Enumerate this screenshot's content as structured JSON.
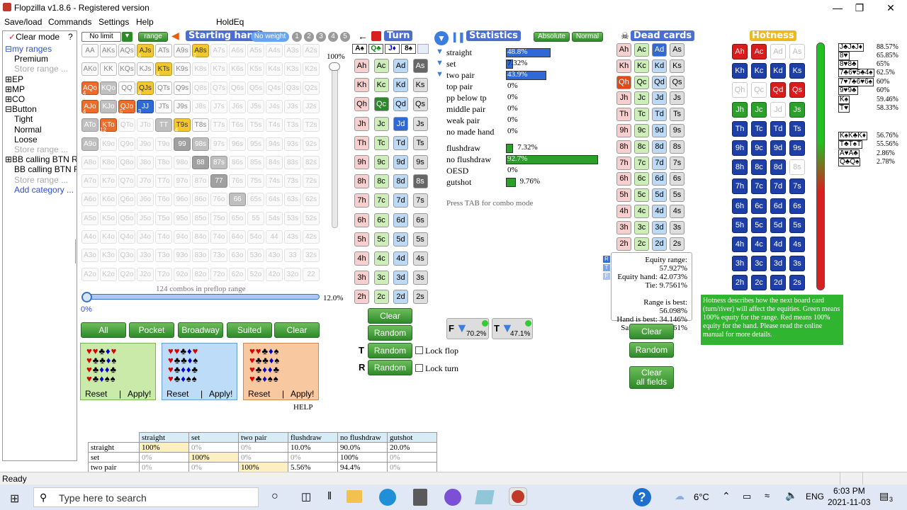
{
  "app": {
    "title": "Flopzilla v1.8.6 - Registered version"
  },
  "menu": {
    "items": [
      "Save/load",
      "Commands",
      "Settings",
      "Help",
      "HoldEq"
    ]
  },
  "left": {
    "clear_mode": "Clear mode",
    "help": "?",
    "items": [
      {
        "t": "⊟my ranges",
        "c": "blue"
      },
      {
        "t": "Premium",
        "c": ""
      },
      {
        "t": "Store range ...",
        "c": "grey"
      },
      {
        "t": "⊞EP",
        "c": ""
      },
      {
        "t": "⊞MP",
        "c": ""
      },
      {
        "t": "⊞CO",
        "c": ""
      },
      {
        "t": "⊟Button",
        "c": ""
      },
      {
        "t": "Tight",
        "c": ""
      },
      {
        "t": "Normal",
        "c": ""
      },
      {
        "t": "Loose",
        "c": ""
      },
      {
        "t": "Store range ...",
        "c": "grey"
      },
      {
        "t": "⊞BB calling BTN R",
        "c": ""
      },
      {
        "t": "BB calling BTN R",
        "c": ""
      },
      {
        "t": "Store range ...",
        "c": "grey"
      },
      {
        "t": "Add category ...",
        "c": "blue"
      }
    ]
  },
  "toolbar": {
    "limit": "No limit",
    "range": "range",
    "starting_hand": "Starting hand",
    "no_weight": "No weight",
    "weights": [
      "1",
      "2",
      "3",
      "4",
      "5"
    ],
    "pct": "100%"
  },
  "grid": {
    "combos": "124 combos in preflop range",
    "pct": "12.0%",
    "zero": "0%",
    "rows": [
      [
        "AA",
        "AKs",
        "AQs",
        "AJs",
        "ATs",
        "A9s",
        "A8s",
        "A7s",
        "A6s",
        "A5s",
        "A4s",
        "A3s",
        "A2s"
      ],
      [
        "AKo",
        "KK",
        "KQs",
        "KJs",
        "KTs",
        "K9s",
        "K8s",
        "K7s",
        "K6s",
        "K5s",
        "K4s",
        "K3s",
        "K2s"
      ],
      [
        "AQo",
        "KQo",
        "QQ",
        "QJs",
        "QTs",
        "Q9s",
        "Q8s",
        "Q7s",
        "Q6s",
        "Q5s",
        "Q4s",
        "Q3s",
        "Q2s"
      ],
      [
        "AJo",
        "KJo",
        "QJo",
        "JJ",
        "JTs",
        "J9s",
        "J8s",
        "J7s",
        "J6s",
        "J5s",
        "J4s",
        "J3s",
        "J2s"
      ],
      [
        "ATo",
        "KTo",
        "QTo",
        "JTo",
        "TT",
        "T9s",
        "T8s",
        "T7s",
        "T6s",
        "T5s",
        "T4s",
        "T3s",
        "T2s"
      ],
      [
        "A9o",
        "K9o",
        "Q9o",
        "J9o",
        "T9o",
        "99",
        "98s",
        "97s",
        "96s",
        "95s",
        "94s",
        "93s",
        "92s"
      ],
      [
        "A8o",
        "K8o",
        "Q8o",
        "J8o",
        "T8o",
        "98o",
        "88",
        "87s",
        "86s",
        "85s",
        "84s",
        "83s",
        "82s"
      ],
      [
        "A7o",
        "K7o",
        "Q7o",
        "J7o",
        "T7o",
        "97o",
        "87o",
        "77",
        "76s",
        "75s",
        "74s",
        "73s",
        "72s"
      ],
      [
        "A6o",
        "K6o",
        "Q6o",
        "J6o",
        "T6o",
        "96o",
        "86o",
        "76o",
        "66",
        "65s",
        "64s",
        "63s",
        "62s"
      ],
      [
        "A5o",
        "K5o",
        "Q5o",
        "J5o",
        "T5o",
        "95o",
        "85o",
        "75o",
        "65o",
        "55",
        "54s",
        "53s",
        "52s"
      ],
      [
        "A4o",
        "K4o",
        "Q4o",
        "J4o",
        "T4o",
        "94o",
        "84o",
        "74o",
        "64o",
        "54o",
        "44",
        "43s",
        "42s"
      ],
      [
        "A3o",
        "K3o",
        "Q3o",
        "J3o",
        "T3o",
        "93o",
        "83o",
        "73o",
        "63o",
        "53o",
        "43o",
        "33",
        "32s"
      ],
      [
        "A2o",
        "K2o",
        "Q2o",
        "J2o",
        "T2o",
        "92o",
        "82o",
        "72o",
        "62o",
        "52o",
        "42o",
        "32o",
        "22"
      ]
    ],
    "badges": {
      "AJs": "4",
      "A8s": "2",
      "KTs": "4",
      "QJs": "4",
      "T9s": "4",
      "AQo": "4",
      "AJo": "4",
      "QJo": "5",
      "JJ": "3",
      "KTo": "12"
    }
  },
  "buttons": {
    "all": "All",
    "pocket": "Pocket",
    "broadway": "Broadway",
    "suited": "Suited",
    "clear": "Clear",
    "reset": "Reset",
    "apply": "Apply!",
    "help": "HELP"
  },
  "board": {
    "title": "Turn",
    "flop": [
      "A♠",
      "Q♣",
      "J♦",
      "8♠"
    ],
    "cards": [
      [
        "Ah",
        "Ac",
        "Ad",
        "As"
      ],
      [
        "Kh",
        "Kc",
        "Kd",
        "Ks"
      ],
      [
        "Qh",
        "Qc",
        "Qd",
        "Qs"
      ],
      [
        "Jh",
        "Jc",
        "Jd",
        "Js"
      ],
      [
        "Th",
        "Tc",
        "Td",
        "Ts"
      ],
      [
        "9h",
        "9c",
        "9d",
        "9s"
      ],
      [
        "8h",
        "8c",
        "8d",
        "8s"
      ],
      [
        "7h",
        "7c",
        "7d",
        "7s"
      ],
      [
        "6h",
        "6c",
        "6d",
        "6s"
      ],
      [
        "5h",
        "5c",
        "5d",
        "5s"
      ],
      [
        "4h",
        "4c",
        "4d",
        "4s"
      ],
      [
        "3h",
        "3c",
        "3d",
        "3s"
      ],
      [
        "2h",
        "2c",
        "2d",
        "2s"
      ]
    ],
    "clear": "Clear",
    "random": "Random",
    "lock_flop": "Lock flop",
    "lock_turn": "Lock turn"
  },
  "stats": {
    "title": "Statistics",
    "absolute": "Absolute",
    "normal": "Normal",
    "tab_hint": "Press TAB for combo mode",
    "rows": [
      {
        "l": "straight",
        "v": "48.8%",
        "p": 48.8
      },
      {
        "l": "set",
        "v": "7.32%",
        "p": 7.32
      },
      {
        "l": "two pair",
        "v": "43.9%",
        "p": 43.9
      },
      {
        "l": "top pair",
        "v": "0%",
        "p": 0
      },
      {
        "l": "pp below tp",
        "v": "0%",
        "p": 0
      },
      {
        "l": "middle pair",
        "v": "0%",
        "p": 0
      },
      {
        "l": "weak pair",
        "v": "0%",
        "p": 0
      },
      {
        "l": "no made hand",
        "v": "0%",
        "p": 0
      }
    ],
    "draws": [
      {
        "l": "flushdraw",
        "v": "7.32%",
        "p": 7.32
      },
      {
        "l": "no flushdraw",
        "v": "92.7%",
        "p": 92.7
      },
      {
        "l": "OESD",
        "v": "0%",
        "p": 0
      },
      {
        "l": "gutshot",
        "v": "9.76%",
        "p": 9.76
      }
    ],
    "filter1": "70.2%",
    "filter2": "47.1%"
  },
  "dead": {
    "title": "Dead cards",
    "clear": "Clear",
    "random": "Random",
    "clear_all": "Clear\nall fields"
  },
  "equity": {
    "lines": [
      "Equity range: 57.927%",
      "Equity hand: 42.073%",
      "Tie: 9.7561%",
      "",
      "Range is best: 56.098%",
      "Hand is best: 34.146%",
      "Same hand: 9.7561%"
    ]
  },
  "hotness": {
    "title": "Hotness",
    "note": "Hotness describes how the next board card (turn/river) will affect the equities. Green means 100% equity for the range. Red means 100% equity for the hand. Please read the online manual for more details.",
    "list": [
      {
        "c": "J♣J♠J♦",
        "v": "88.57%"
      },
      {
        "c": "8♥",
        "v": "65.85%"
      },
      {
        "c": "8♥8♣",
        "v": "65%"
      },
      {
        "c": "7♣6♥5♣4♠",
        "v": "62.5%"
      },
      {
        "c": "7♥7♣6♥6♠",
        "v": "60%"
      },
      {
        "c": "9♥9♣",
        "v": "60%"
      },
      {
        "c": "K♠",
        "v": "59.46%"
      },
      {
        "c": "T♥",
        "v": "58.33%"
      },
      {
        "c": "K♠K♣K♦",
        "v": "56.76%"
      },
      {
        "c": "T♣T♠T",
        "v": "55.56%"
      },
      {
        "c": "A♥A♣",
        "v": "2.86%"
      },
      {
        "c": "Q♣Q♠",
        "v": "2.78%"
      }
    ]
  },
  "table": {
    "headers": [
      "",
      "straight",
      "set",
      "two pair",
      "flushdraw",
      "no flushdraw",
      "gutshot"
    ],
    "rows": [
      [
        "straight",
        "100%",
        "0%",
        "0%",
        "10.0%",
        "90.0%",
        "20.0%"
      ],
      [
        "set",
        "0%",
        "100%",
        "0%",
        "0%",
        "100%",
        "0%"
      ],
      [
        "two pair",
        "0%",
        "0%",
        "100%",
        "5.56%",
        "94.4%",
        "0%"
      ]
    ]
  },
  "status": "Ready",
  "taskbar": {
    "search": "Type here to search",
    "temp": "6°C",
    "lang": "ENG",
    "time": "6:03 PM",
    "date": "2021-11-03",
    "notif": "3"
  }
}
